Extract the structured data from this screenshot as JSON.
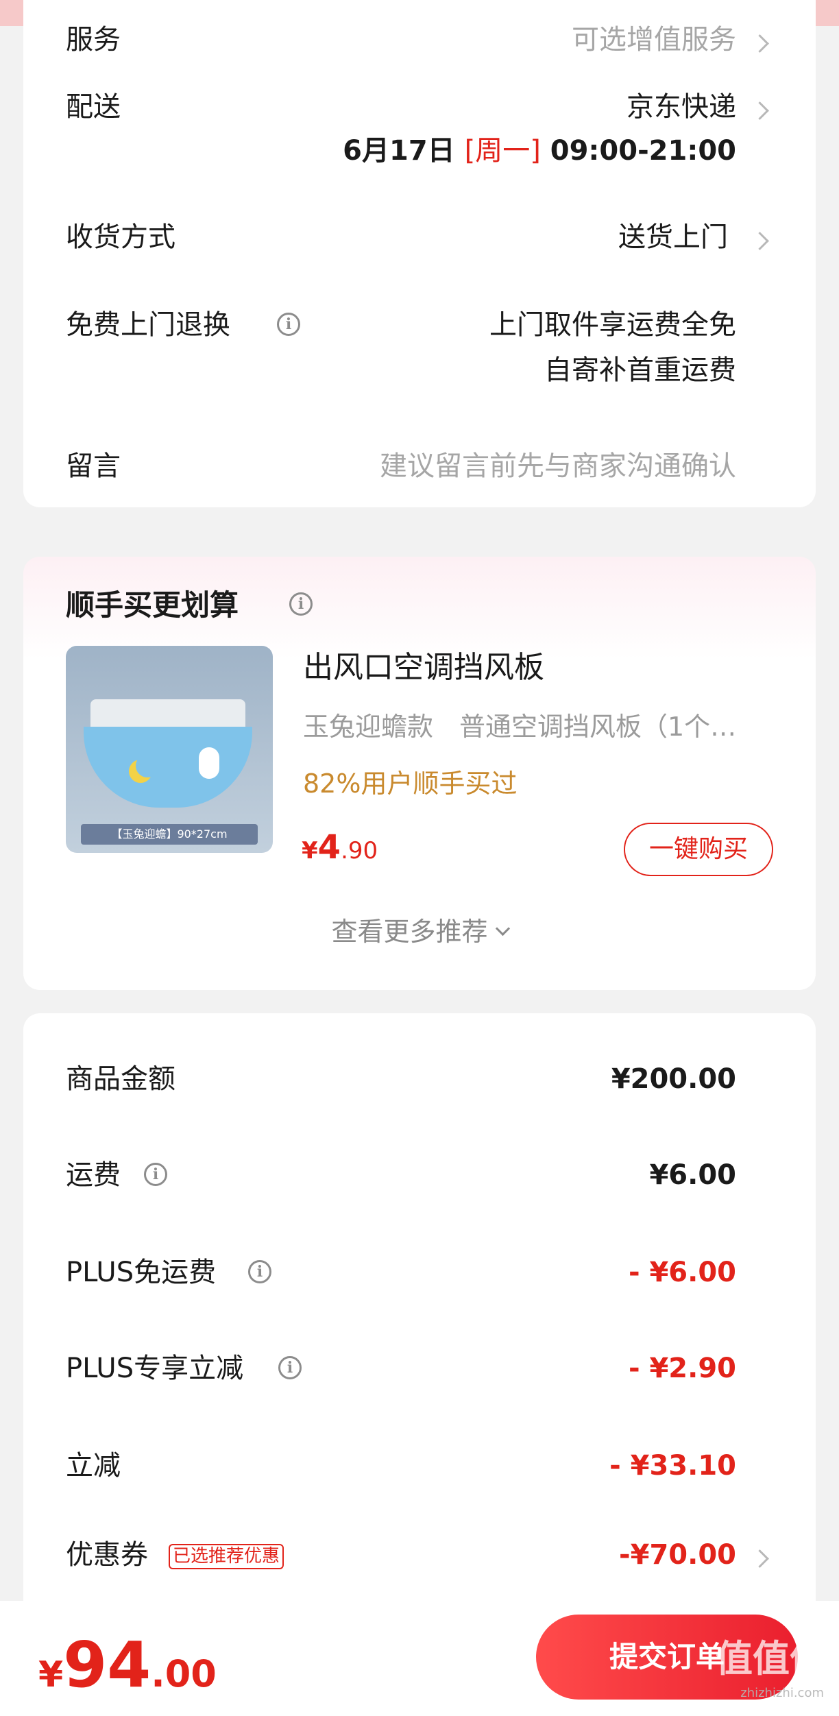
{
  "order": {
    "service": {
      "label": "服务",
      "value": "可选增值服务"
    },
    "delivery": {
      "label": "配送",
      "value": "京东快递",
      "date": "6月17日",
      "weekday": "[周一]",
      "time": "09:00-21:00"
    },
    "receive": {
      "label": "收货方式",
      "value": "送货上门"
    },
    "free_return": {
      "label": "免费上门退换",
      "line1": "上门取件享运费全免",
      "line2": "自寄补首重运费"
    },
    "message": {
      "label": "留言",
      "placeholder": "建议留言前先与商家沟通确认"
    }
  },
  "recommend": {
    "title": "顺手买更划算",
    "image_caption": "【玉兔迎蟾】90*27cm",
    "product_name": "出风口空调挡风板",
    "spec": "玉兔迎蟾款　普通空调挡风板（1个…",
    "social_proof": "82%用户顺手买过",
    "price_symbol": "¥",
    "price_int": "4",
    "price_dec": ".90",
    "buy_button": "一键购买",
    "more": "查看更多推荐"
  },
  "summary": {
    "goods_amount": {
      "label": "商品金额",
      "value": "¥200.00"
    },
    "shipping": {
      "label": "运费",
      "value": "¥6.00"
    },
    "plus_free_shipping": {
      "label": "PLUS免运费",
      "value": "- ¥6.00"
    },
    "plus_discount": {
      "label": "PLUS专享立减",
      "value": "- ¥2.90"
    },
    "instant_discount": {
      "label": "立减",
      "value": "- ¥33.10"
    },
    "coupon": {
      "label": "优惠券",
      "tag": "已选推荐优惠",
      "value": "-¥70.00"
    }
  },
  "bottom": {
    "currency": "¥",
    "total_int": "94",
    "total_dec": ".00",
    "submit": "提交订单",
    "watermark": "值值值",
    "watermark_url": "zhizhizhi.com"
  },
  "colors": {
    "accent": "#e2231a",
    "orange_note": "#c98a2e",
    "background": "#f2f2f2"
  }
}
